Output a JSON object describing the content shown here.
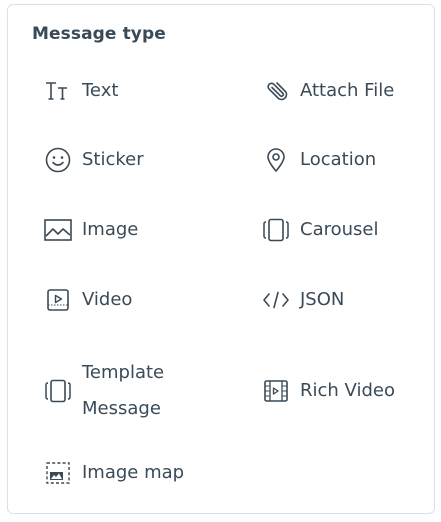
{
  "panel": {
    "title": "Message type"
  },
  "message_types": {
    "text": {
      "label": "Text",
      "icon": "text-format-icon"
    },
    "attach_file": {
      "label": "Attach File",
      "icon": "paperclip-icon"
    },
    "sticker": {
      "label": "Sticker",
      "icon": "smiley-icon"
    },
    "location": {
      "label": "Location",
      "icon": "map-pin-icon"
    },
    "image": {
      "label": "Image",
      "icon": "image-icon"
    },
    "carousel": {
      "label": "Carousel",
      "icon": "carousel-icon"
    },
    "video": {
      "label": "Video",
      "icon": "video-icon"
    },
    "json": {
      "label": "JSON",
      "icon": "code-icon"
    },
    "template_message": {
      "label": "Template Message",
      "icon": "template-icon"
    },
    "rich_video": {
      "label": "Rich Video",
      "icon": "film-icon"
    },
    "image_map": {
      "label": "Image map",
      "icon": "image-map-icon"
    }
  }
}
